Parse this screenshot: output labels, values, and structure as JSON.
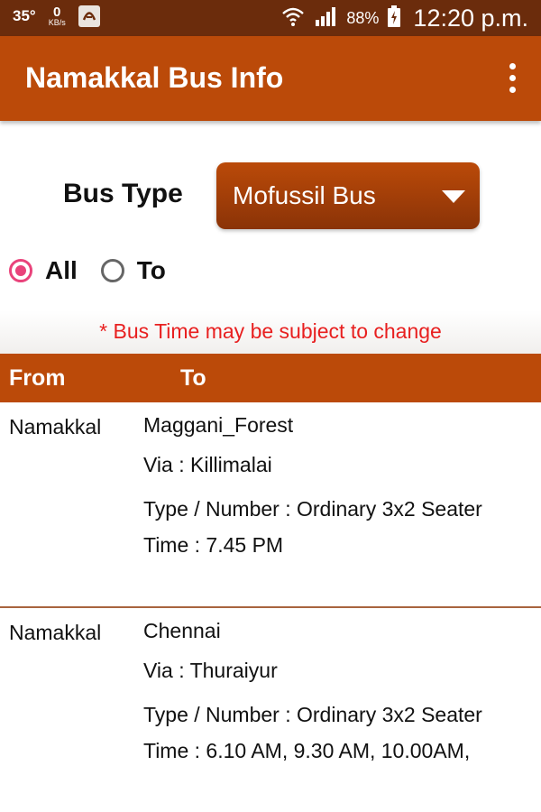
{
  "status_bar": {
    "temperature": "35°",
    "net_speed_value": "0",
    "net_speed_unit": "KB/s",
    "battery_percent": "88%",
    "time": "12:20 p.m."
  },
  "app_bar": {
    "title": "Namakkal Bus Info"
  },
  "bus_type": {
    "label": "Bus Type",
    "selected": "Mofussil Bus"
  },
  "filter": {
    "options": [
      {
        "label": "All",
        "checked": true
      },
      {
        "label": "To",
        "checked": false
      }
    ]
  },
  "notice": "* Bus Time may be subject to change",
  "table": {
    "headers": {
      "from": "From",
      "to": "To"
    },
    "rows": [
      {
        "from": "Namakkal",
        "to": "Maggani_Forest",
        "via": "Via : Killimalai",
        "type": "Type / Number :  Ordinary 3x2 Seater",
        "time": "Time : 7.45 PM"
      },
      {
        "from": "Namakkal",
        "to": "Chennai",
        "via": "Via : Thuraiyur",
        "type": "Type / Number :  Ordinary 3x2 Seater",
        "time": "Time : 6.10 AM,  9.30 AM,  10.00AM,"
      }
    ]
  },
  "colors": {
    "status_bar": "#6b2c0c",
    "primary": "#bb4a09",
    "radio_accent": "#e9437b",
    "notice_text": "#e81f1f"
  }
}
